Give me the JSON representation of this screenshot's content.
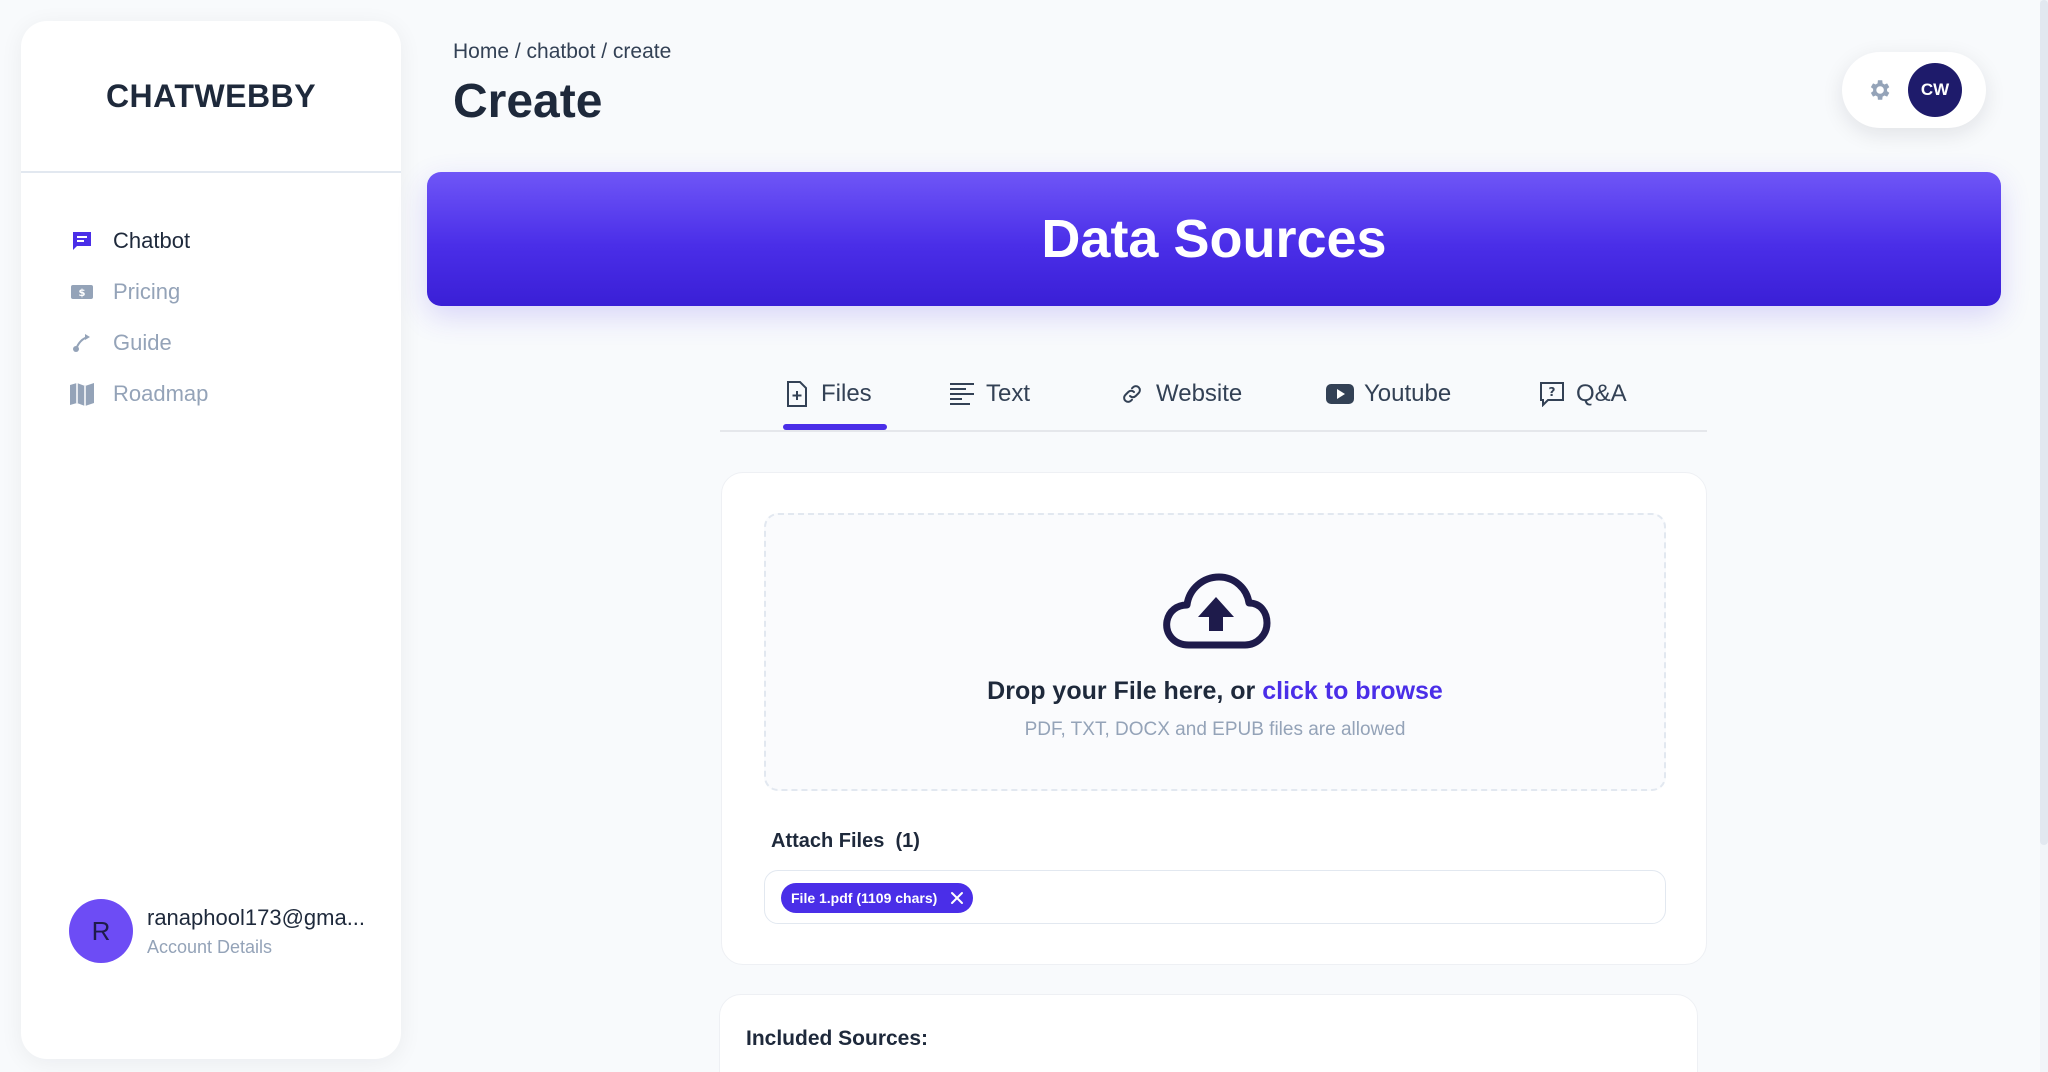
{
  "sidebar": {
    "brand": "CHATWEBBY",
    "items": [
      {
        "label": "Chatbot",
        "icon": "chat-icon",
        "active": true
      },
      {
        "label": "Pricing",
        "icon": "money-icon"
      },
      {
        "label": "Guide",
        "icon": "route-icon"
      },
      {
        "label": "Roadmap",
        "icon": "map-icon"
      }
    ],
    "account": {
      "initial": "R",
      "email": "ranaphool173@gma...",
      "details_label": "Account Details"
    }
  },
  "header": {
    "breadcrumb": "Home  / chatbot / create",
    "title": "Create",
    "avatar_initials": "CW"
  },
  "banner": {
    "title": "Data Sources"
  },
  "tabs": [
    {
      "label": "Files",
      "icon": "file-plus-icon",
      "active": true
    },
    {
      "label": "Text",
      "icon": "text-lines-icon"
    },
    {
      "label": "Website",
      "icon": "link-icon"
    },
    {
      "label": "Youtube",
      "icon": "youtube-icon"
    },
    {
      "label": "Q&A",
      "icon": "question-box-icon"
    }
  ],
  "upload": {
    "drop_text": "Drop your File here, or ",
    "browse_text": "click to browse",
    "allowed_text": "PDF, TXT, DOCX and EPUB files are allowed",
    "attach_label": "Attach Files",
    "attach_count": "(1)",
    "files": [
      {
        "label": "File 1.pdf (1109 chars)"
      }
    ]
  },
  "sources": {
    "title": "Included Sources:"
  },
  "colors": {
    "accent": "#4a2ee8",
    "banner_top": "#6f56f7",
    "banner_bottom": "#3a1fd6",
    "avatar": "#1e1b6b"
  }
}
